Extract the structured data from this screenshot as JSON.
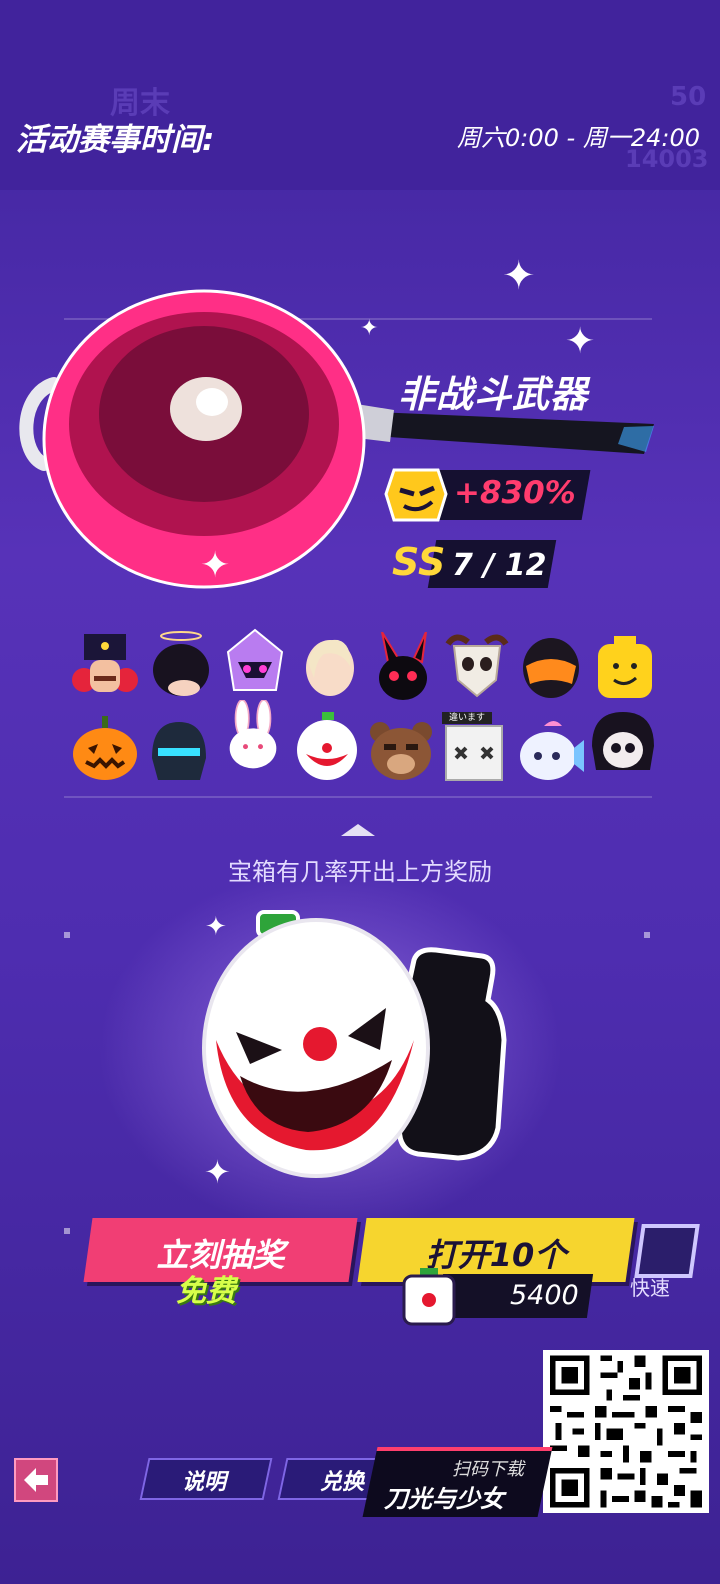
{
  "header": {
    "background_text": "周末",
    "background_numbers": [
      "50",
      "14003"
    ],
    "event_label": "活动赛事时间:",
    "event_time": "周六0:00 - 周一24:00"
  },
  "featured": {
    "weapon_icon": "frying-pan",
    "weapon_name": "非战斗武器",
    "bonus": "+830%",
    "rarity": "SS",
    "progress": "7 / 12"
  },
  "rewards": [
    "nutcracker-hat",
    "black-hair-halo",
    "purple-mech-helmet",
    "blonde-hair",
    "black-bunny-mask",
    "goat-skull-mask",
    "orange-visor-helmet",
    "yellow-brick-head",
    "pumpkin-head",
    "knight-helmet",
    "white-rabbit-head",
    "clown-face",
    "bear-head",
    "box-head",
    "fish-head",
    "reaper-skull"
  ],
  "box_sign_text": "違います",
  "hint_text": "宝箱有几率开出上方奖励",
  "chest_icon": "clown-thumbs-up",
  "buttons": {
    "draw_now": "立刻抽奖",
    "draw_now_sub": "免费",
    "open_ten": "打开10个",
    "open_ten_cost": "5400",
    "quick": "快速"
  },
  "footer": {
    "explain": "说明",
    "exchange": "兑换",
    "download_small": "扫码下载",
    "download_big": "刀光与少女"
  },
  "colors": {
    "accent_pink": "#f13e74",
    "accent_yellow": "#f6d52e",
    "bonus_text": "#ff3c6e",
    "free_text": "#d8ff4a",
    "background": "#4a2aa6"
  }
}
